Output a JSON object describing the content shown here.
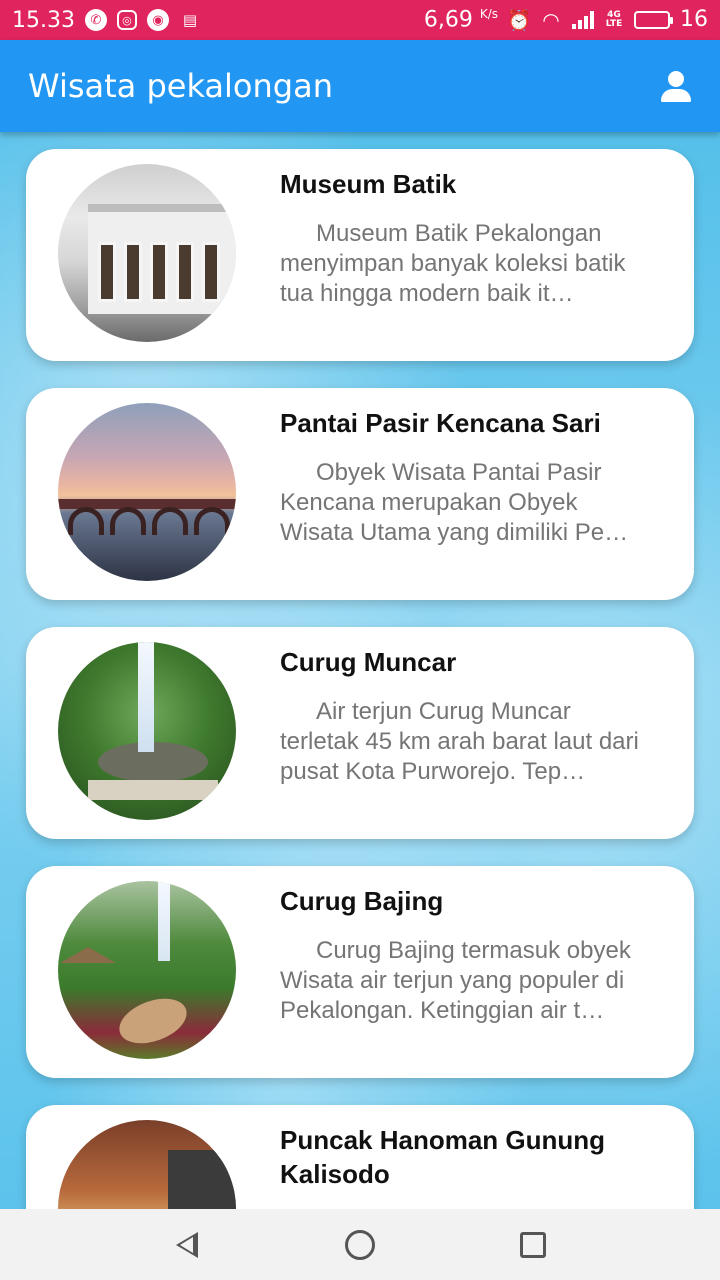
{
  "status_bar": {
    "time": "15.33",
    "speed_value": "6,69",
    "speed_unit": "K/s",
    "battery_level": "16",
    "network_label": "4G LTE",
    "icons": [
      "whatsapp-icon",
      "instagram-icon",
      "chrome-icon",
      "sd-card-icon",
      "alarm-icon",
      "wifi-icon",
      "signal-icon",
      "battery-icon"
    ]
  },
  "app_bar": {
    "title": "Wisata pekalongan",
    "account_icon": "account-icon",
    "background": "#2196f3"
  },
  "places": [
    {
      "title": "Museum Batik",
      "description": "Museum Batik Pekalongan menyimpan banyak koleksi batik tua hingga modern baik it…"
    },
    {
      "title": "Pantai Pasir Kencana Sari",
      "description": "Obyek Wisata Pantai Pasir Kencana merupakan Obyek Wisata Utama yang dimiliki Pe…"
    },
    {
      "title": "Curug Muncar",
      "description": "Air terjun Curug Muncar terletak 45 km arah barat laut dari pusat Kota Purworejo. Tep…"
    },
    {
      "title": "Curug Bajing",
      "description": "Curug Bajing termasuk obyek Wisata air terjun yang populer di Pekalongan. Ketinggian air t…"
    },
    {
      "title": "Puncak Hanoman Gunung Kalisodo",
      "description": ""
    }
  ],
  "nav_bar": {
    "icons": [
      "back-icon",
      "home-icon",
      "recents-icon"
    ]
  },
  "colors": {
    "status_bar": "#e0245e",
    "app_bar": "#2196f3",
    "card": "#ffffff",
    "title_text": "#111111",
    "description_text": "#757575"
  }
}
